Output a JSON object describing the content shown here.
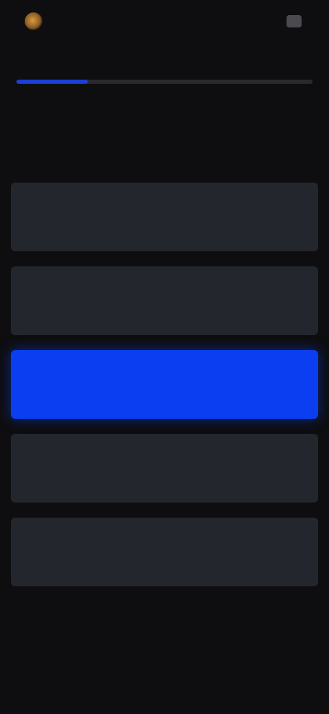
{
  "progress": {
    "fraction": 0.24
  },
  "question": {
    "text": ""
  },
  "options": [
    {
      "label": "",
      "selected": false
    },
    {
      "label": "",
      "selected": false
    },
    {
      "label": "",
      "selected": true
    },
    {
      "label": "",
      "selected": false
    },
    {
      "label": "",
      "selected": false
    }
  ],
  "colors": {
    "background": "#0e0e10",
    "option_bg": "#23262d",
    "accent": "#0a3ef0",
    "progress_fill": "#1c3fd8"
  }
}
